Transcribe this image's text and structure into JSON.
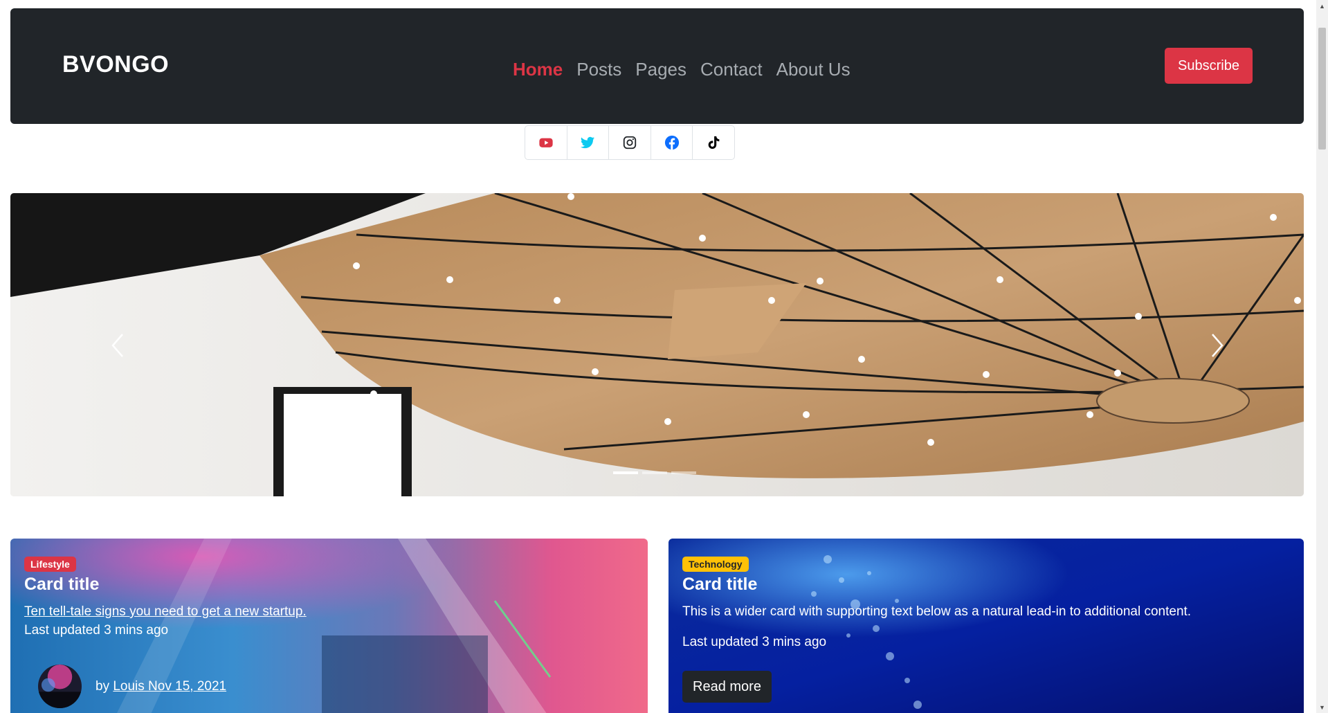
{
  "navbar": {
    "brand": "BVONGO",
    "links": [
      {
        "label": "Home",
        "active": true
      },
      {
        "label": "Posts",
        "active": false
      },
      {
        "label": "Pages",
        "active": false
      },
      {
        "label": "Contact",
        "active": false
      },
      {
        "label": "About Us",
        "active": false
      }
    ],
    "subscribe_label": "Subscribe"
  },
  "social": [
    {
      "icon": "youtube-icon",
      "color": "#dc3545"
    },
    {
      "icon": "twitter-icon",
      "color": "#0dcaf0"
    },
    {
      "icon": "instagram-icon",
      "color": "#212529"
    },
    {
      "icon": "facebook-icon",
      "color": "#0d6efd"
    },
    {
      "icon": "tiktok-icon",
      "color": "#000000"
    }
  ],
  "carousel": {
    "slide_count": 3,
    "active_slide": 0,
    "prev_icon": "chevron-left-icon",
    "next_icon": "chevron-right-icon"
  },
  "cards": {
    "left": {
      "badge": "Lifestyle",
      "title": "Card title",
      "link_text": "Ten tell-tale signs you need to get a new startup.",
      "updated": "Last updated 3 mins ago",
      "by": "by",
      "author": "Louis Nov 15, 2021"
    },
    "right": {
      "badge": "Technology",
      "title": "Card title",
      "text": "This is a wider card with supporting text below as a natural lead-in to additional content.",
      "updated": "Last updated 3 mins ago",
      "button_label": "Read more"
    }
  },
  "colors": {
    "navbar_bg": "#212529",
    "accent": "#dc3545",
    "nav_muted": "#a7acb1",
    "badge_yellow": "#ffc107"
  }
}
